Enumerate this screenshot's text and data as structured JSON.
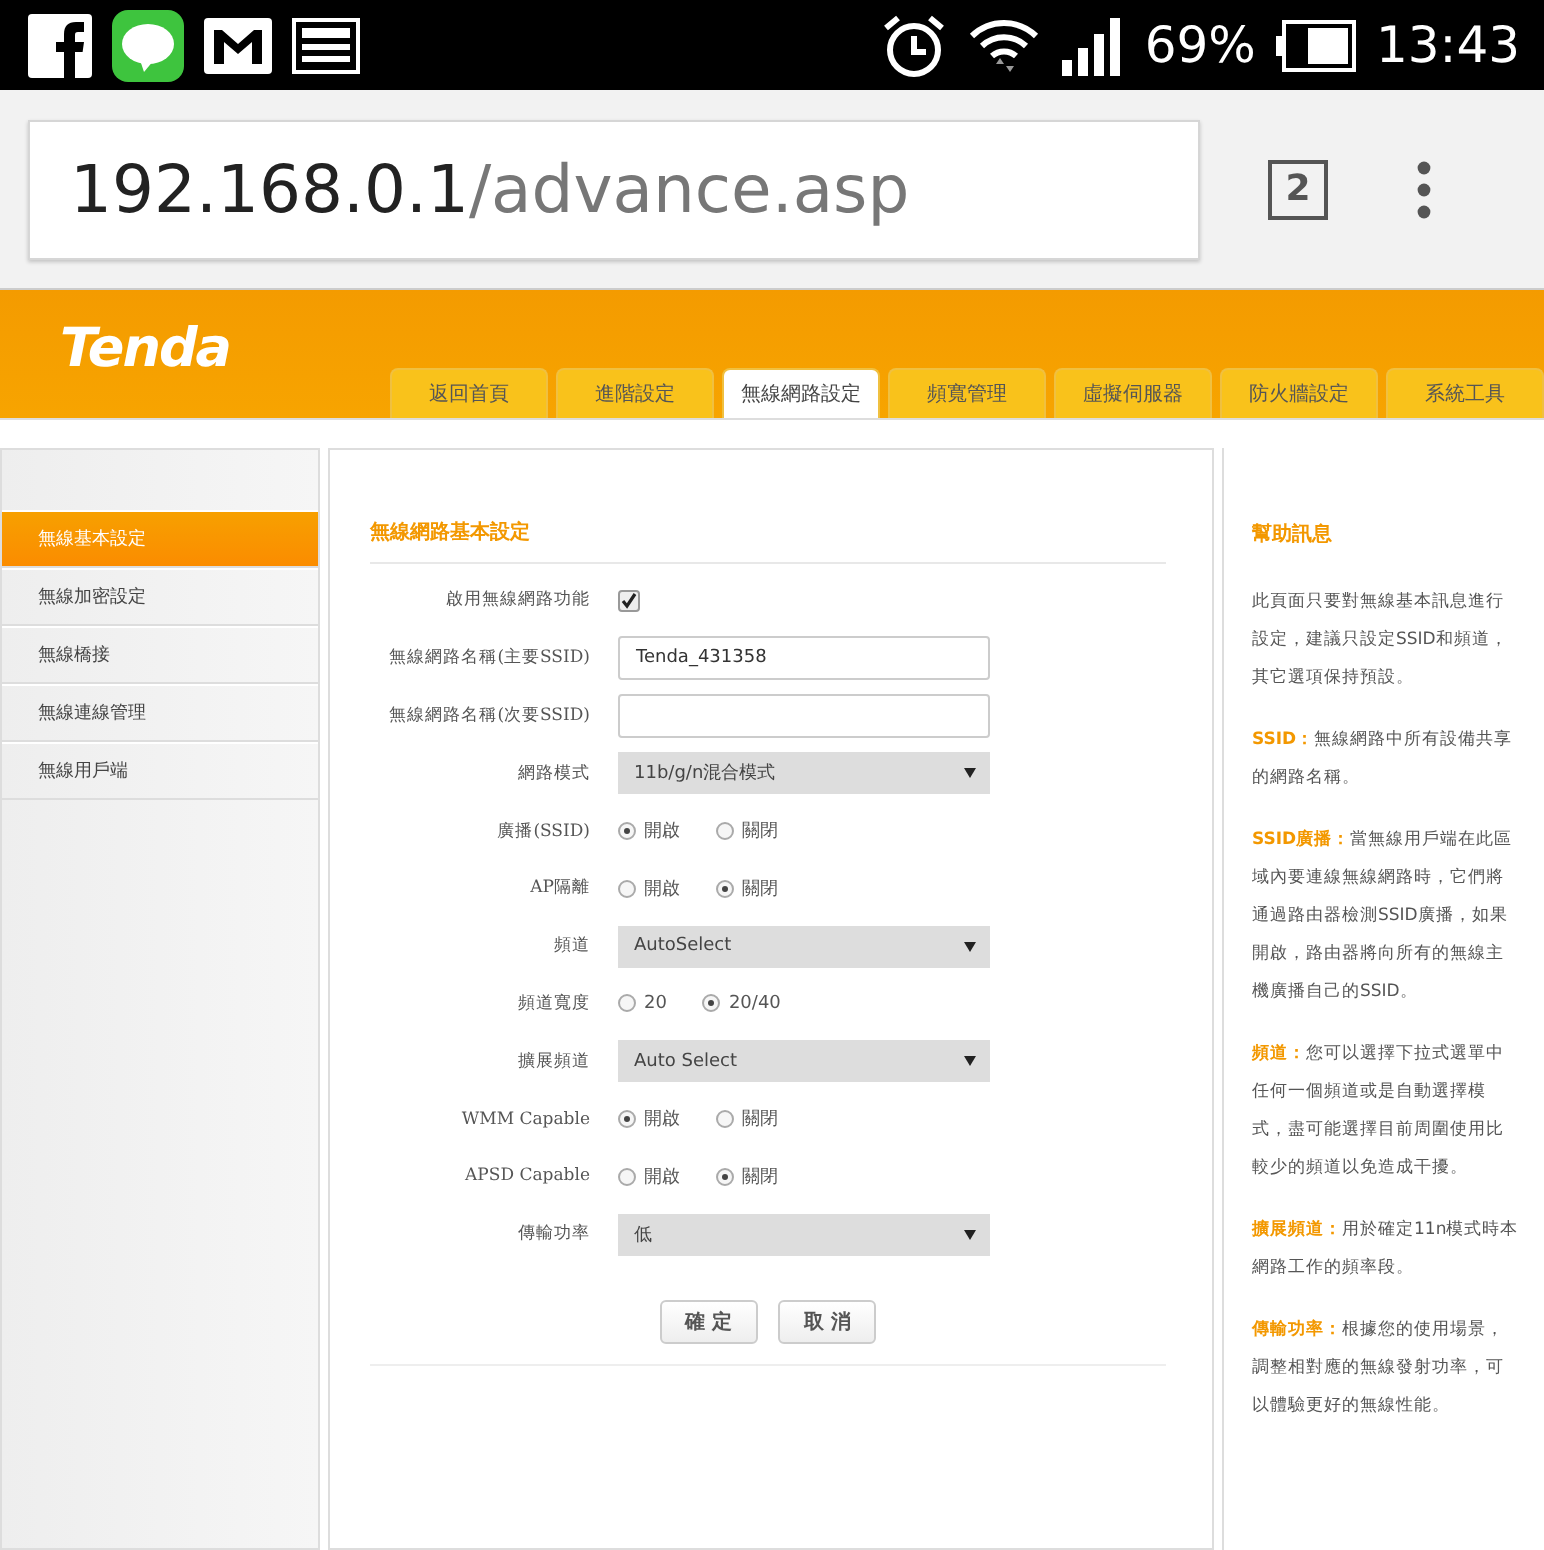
{
  "status_bar": {
    "battery_text": "69%",
    "time": "13:43"
  },
  "browser": {
    "url_host": "192.168.0.1",
    "url_path": "/advance.asp",
    "tab_count": "2"
  },
  "header": {
    "logo": "Tenda"
  },
  "tabs": [
    {
      "label": "返回首頁",
      "selected": false
    },
    {
      "label": "進階設定",
      "selected": false
    },
    {
      "label": "無線網路設定",
      "selected": true
    },
    {
      "label": "頻寬管理",
      "selected": false
    },
    {
      "label": "虛擬伺服器",
      "selected": false
    },
    {
      "label": "防火牆設定",
      "selected": false
    },
    {
      "label": "系統工具",
      "selected": false
    }
  ],
  "sidebar": {
    "items": [
      {
        "label": "無線基本設定",
        "selected": true
      },
      {
        "label": "無線加密設定",
        "selected": false
      },
      {
        "label": "無線橋接",
        "selected": false
      },
      {
        "label": "無線連線管理",
        "selected": false
      },
      {
        "label": "無線用戶端",
        "selected": false
      }
    ]
  },
  "form": {
    "title": "無線網路基本設定",
    "rows": [
      {
        "kind": "checkbox",
        "label": "啟用無線網路功能",
        "checked": true
      },
      {
        "kind": "text",
        "label": "無線網路名稱(主要SSID)",
        "value": "Tenda_431358"
      },
      {
        "kind": "text",
        "label": "無線網路名稱(次要SSID)"
      },
      {
        "kind": "select",
        "label": "網路模式",
        "value": "11b/g/n混合模式"
      },
      {
        "kind": "radio",
        "label": "廣播(SSID)",
        "options": [
          {
            "label": "開啟",
            "selected": true
          },
          {
            "label": "關閉",
            "selected": false
          }
        ]
      },
      {
        "kind": "radio",
        "label": "AP隔離",
        "options": [
          {
            "label": "開啟",
            "selected": false
          },
          {
            "label": "關閉",
            "selected": true
          }
        ]
      },
      {
        "kind": "select",
        "label": "頻道",
        "value": "AutoSelect"
      },
      {
        "kind": "radio",
        "label": "頻道寬度",
        "options": [
          {
            "label": "20",
            "selected": false
          },
          {
            "label": "20/40",
            "selected": true
          }
        ]
      },
      {
        "kind": "select",
        "label": "擴展頻道",
        "value": "Auto Select"
      },
      {
        "kind": "radio",
        "label": "WMM Capable",
        "options": [
          {
            "label": "開啟",
            "selected": true
          },
          {
            "label": "關閉",
            "selected": false
          }
        ]
      },
      {
        "kind": "radio",
        "label": "APSD Capable",
        "options": [
          {
            "label": "開啟",
            "selected": false
          },
          {
            "label": "關閉",
            "selected": true
          }
        ]
      },
      {
        "kind": "select",
        "label": "傳輸功率",
        "value": "低"
      }
    ],
    "buttons": [
      "確 定",
      "取 消"
    ]
  },
  "help": {
    "title": "幫助訊息",
    "paragraphs": [
      {
        "text": "此頁面只要對無線基本訊息進行設定，建議只設定SSID和頻道，其它選項保持預設。"
      },
      {
        "term": "SSID：",
        "text": "無線網路中所有設備共享的網路名稱。"
      },
      {
        "term": "SSID廣播：",
        "text": "當無線用戶端在此區域內要連線無線網路時，它們將通過路由器檢測SSID廣播，如果開啟，路由器將向所有的無線主機廣播自己的SSID。"
      },
      {
        "term": "頻道：",
        "text": "您可以選擇下拉式選單中任何一個頻道或是自動選擇模式，盡可能選擇目前周圍使用比較少的頻道以免造成干擾。"
      },
      {
        "term": "擴展頻道：",
        "text": "用於確定11n模式時本網路工作的頻率段。"
      },
      {
        "term": "傳輸功率：",
        "text": "根據您的使用場景，調整相對應的無線發射功率，可以體驗更好的無線性能。"
      }
    ]
  }
}
